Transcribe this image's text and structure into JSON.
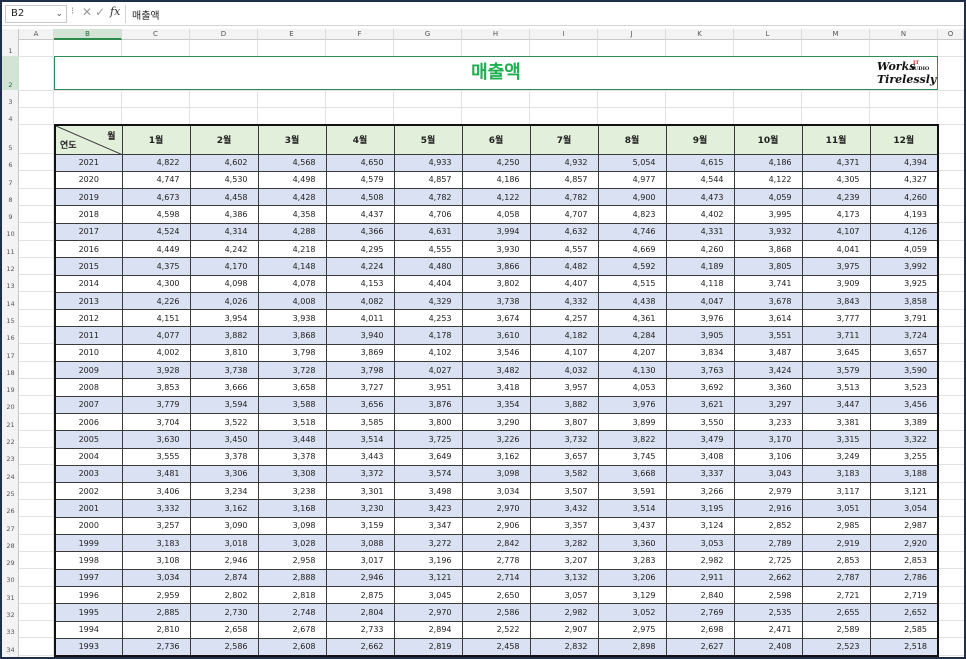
{
  "formula_bar": {
    "cell_ref": "B2",
    "dropdown_icon": "chevron-down-icon",
    "fx_label": "fx",
    "value": "매출액"
  },
  "columns": [
    "A",
    "B",
    "C",
    "D",
    "E",
    "F",
    "G",
    "H",
    "I",
    "J",
    "K",
    "L",
    "M",
    "N",
    "O"
  ],
  "selected_column": "B",
  "rows": [
    "1",
    "2",
    "3",
    "4",
    "5",
    "6",
    "7",
    "8",
    "9",
    "10",
    "11",
    "12",
    "13",
    "14",
    "15",
    "16",
    "17",
    "18",
    "19",
    "20",
    "21",
    "22",
    "23",
    "24",
    "25",
    "26",
    "27",
    "28",
    "29",
    "30",
    "31",
    "32",
    "33",
    "34"
  ],
  "selected_row": "2",
  "sheet": {
    "title": "매출액",
    "logo": {
      "line1": "Works",
      "line2": "Tirelessly",
      "tag1": "IT",
      "tag2": "AUDIO"
    },
    "corner_month": "월",
    "corner_year": "연도",
    "months": [
      "1월",
      "2월",
      "3월",
      "4월",
      "5월",
      "6월",
      "7월",
      "8월",
      "9월",
      "10월",
      "11월",
      "12월"
    ],
    "data": [
      [
        "2021",
        "4,822",
        "4,602",
        "4,568",
        "4,650",
        "4,933",
        "4,250",
        "4,932",
        "5,054",
        "4,615",
        "4,186",
        "4,371",
        "4,394"
      ],
      [
        "2020",
        "4,747",
        "4,530",
        "4,498",
        "4,579",
        "4,857",
        "4,186",
        "4,857",
        "4,977",
        "4,544",
        "4,122",
        "4,305",
        "4,327"
      ],
      [
        "2019",
        "4,673",
        "4,458",
        "4,428",
        "4,508",
        "4,782",
        "4,122",
        "4,782",
        "4,900",
        "4,473",
        "4,059",
        "4,239",
        "4,260"
      ],
      [
        "2018",
        "4,598",
        "4,386",
        "4,358",
        "4,437",
        "4,706",
        "4,058",
        "4,707",
        "4,823",
        "4,402",
        "3,995",
        "4,173",
        "4,193"
      ],
      [
        "2017",
        "4,524",
        "4,314",
        "4,288",
        "4,366",
        "4,631",
        "3,994",
        "4,632",
        "4,746",
        "4,331",
        "3,932",
        "4,107",
        "4,126"
      ],
      [
        "2016",
        "4,449",
        "4,242",
        "4,218",
        "4,295",
        "4,555",
        "3,930",
        "4,557",
        "4,669",
        "4,260",
        "3,868",
        "4,041",
        "4,059"
      ],
      [
        "2015",
        "4,375",
        "4,170",
        "4,148",
        "4,224",
        "4,480",
        "3,866",
        "4,482",
        "4,592",
        "4,189",
        "3,805",
        "3,975",
        "3,992"
      ],
      [
        "2014",
        "4,300",
        "4,098",
        "4,078",
        "4,153",
        "4,404",
        "3,802",
        "4,407",
        "4,515",
        "4,118",
        "3,741",
        "3,909",
        "3,925"
      ],
      [
        "2013",
        "4,226",
        "4,026",
        "4,008",
        "4,082",
        "4,329",
        "3,738",
        "4,332",
        "4,438",
        "4,047",
        "3,678",
        "3,843",
        "3,858"
      ],
      [
        "2012",
        "4,151",
        "3,954",
        "3,938",
        "4,011",
        "4,253",
        "3,674",
        "4,257",
        "4,361",
        "3,976",
        "3,614",
        "3,777",
        "3,791"
      ],
      [
        "2011",
        "4,077",
        "3,882",
        "3,868",
        "3,940",
        "4,178",
        "3,610",
        "4,182",
        "4,284",
        "3,905",
        "3,551",
        "3,711",
        "3,724"
      ],
      [
        "2010",
        "4,002",
        "3,810",
        "3,798",
        "3,869",
        "4,102",
        "3,546",
        "4,107",
        "4,207",
        "3,834",
        "3,487",
        "3,645",
        "3,657"
      ],
      [
        "2009",
        "3,928",
        "3,738",
        "3,728",
        "3,798",
        "4,027",
        "3,482",
        "4,032",
        "4,130",
        "3,763",
        "3,424",
        "3,579",
        "3,590"
      ],
      [
        "2008",
        "3,853",
        "3,666",
        "3,658",
        "3,727",
        "3,951",
        "3,418",
        "3,957",
        "4,053",
        "3,692",
        "3,360",
        "3,513",
        "3,523"
      ],
      [
        "2007",
        "3,779",
        "3,594",
        "3,588",
        "3,656",
        "3,876",
        "3,354",
        "3,882",
        "3,976",
        "3,621",
        "3,297",
        "3,447",
        "3,456"
      ],
      [
        "2006",
        "3,704",
        "3,522",
        "3,518",
        "3,585",
        "3,800",
        "3,290",
        "3,807",
        "3,899",
        "3,550",
        "3,233",
        "3,381",
        "3,389"
      ],
      [
        "2005",
        "3,630",
        "3,450",
        "3,448",
        "3,514",
        "3,725",
        "3,226",
        "3,732",
        "3,822",
        "3,479",
        "3,170",
        "3,315",
        "3,322"
      ],
      [
        "2004",
        "3,555",
        "3,378",
        "3,378",
        "3,443",
        "3,649",
        "3,162",
        "3,657",
        "3,745",
        "3,408",
        "3,106",
        "3,249",
        "3,255"
      ],
      [
        "2003",
        "3,481",
        "3,306",
        "3,308",
        "3,372",
        "3,574",
        "3,098",
        "3,582",
        "3,668",
        "3,337",
        "3,043",
        "3,183",
        "3,188"
      ],
      [
        "2002",
        "3,406",
        "3,234",
        "3,238",
        "3,301",
        "3,498",
        "3,034",
        "3,507",
        "3,591",
        "3,266",
        "2,979",
        "3,117",
        "3,121"
      ],
      [
        "2001",
        "3,332",
        "3,162",
        "3,168",
        "3,230",
        "3,423",
        "2,970",
        "3,432",
        "3,514",
        "3,195",
        "2,916",
        "3,051",
        "3,054"
      ],
      [
        "2000",
        "3,257",
        "3,090",
        "3,098",
        "3,159",
        "3,347",
        "2,906",
        "3,357",
        "3,437",
        "3,124",
        "2,852",
        "2,985",
        "2,987"
      ],
      [
        "1999",
        "3,183",
        "3,018",
        "3,028",
        "3,088",
        "3,272",
        "2,842",
        "3,282",
        "3,360",
        "3,053",
        "2,789",
        "2,919",
        "2,920"
      ],
      [
        "1998",
        "3,108",
        "2,946",
        "2,958",
        "3,017",
        "3,196",
        "2,778",
        "3,207",
        "3,283",
        "2,982",
        "2,725",
        "2,853",
        "2,853"
      ],
      [
        "1997",
        "3,034",
        "2,874",
        "2,888",
        "2,946",
        "3,121",
        "2,714",
        "3,132",
        "3,206",
        "2,911",
        "2,662",
        "2,787",
        "2,786"
      ],
      [
        "1996",
        "2,959",
        "2,802",
        "2,818",
        "2,875",
        "3,045",
        "2,650",
        "3,057",
        "3,129",
        "2,840",
        "2,598",
        "2,721",
        "2,719"
      ],
      [
        "1995",
        "2,885",
        "2,730",
        "2,748",
        "2,804",
        "2,970",
        "2,586",
        "2,982",
        "3,052",
        "2,769",
        "2,535",
        "2,655",
        "2,652"
      ],
      [
        "1994",
        "2,810",
        "2,658",
        "2,678",
        "2,733",
        "2,894",
        "2,522",
        "2,907",
        "2,975",
        "2,698",
        "2,471",
        "2,589",
        "2,585"
      ],
      [
        "1993",
        "2,736",
        "2,586",
        "2,608",
        "2,662",
        "2,819",
        "2,458",
        "2,832",
        "2,898",
        "2,627",
        "2,408",
        "2,523",
        "2,518"
      ]
    ]
  },
  "colors": {
    "title": "#1fae50",
    "header_fill": "#e2efda",
    "band_fill": "#d9e1f2",
    "selection": "#2f8a4e"
  }
}
